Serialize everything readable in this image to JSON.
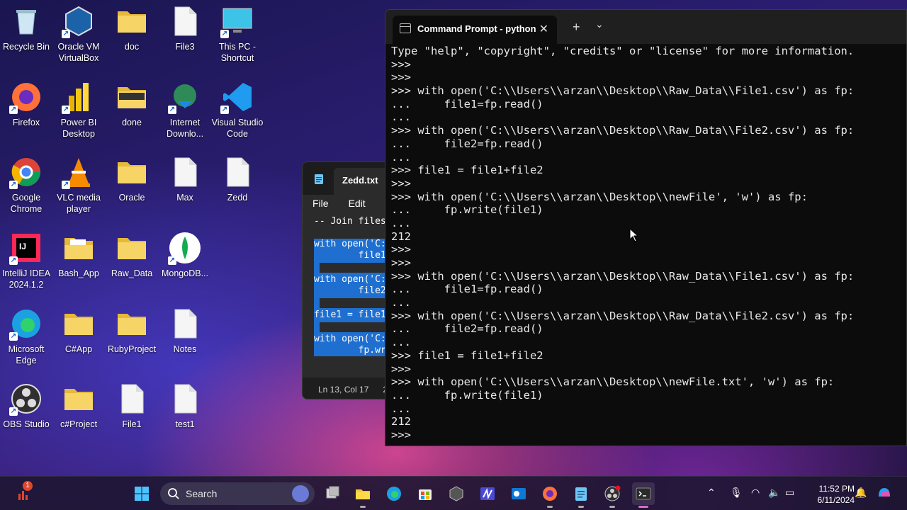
{
  "desktop": {
    "icons": [
      {
        "label": "Recycle Bin"
      },
      {
        "label": "Oracle VM VirtualBox"
      },
      {
        "label": "doc"
      },
      {
        "label": "File3"
      },
      {
        "label": "This PC - Shortcut"
      },
      {
        "label": "Firefox"
      },
      {
        "label": "Power BI Desktop"
      },
      {
        "label": "done"
      },
      {
        "label": "Internet Downlo..."
      },
      {
        "label": "Visual Studio Code"
      },
      {
        "label": "Google Chrome"
      },
      {
        "label": "VLC media player"
      },
      {
        "label": "Oracle"
      },
      {
        "label": "Max"
      },
      {
        "label": "Zedd"
      },
      {
        "label": "IntelliJ IDEA 2024.1.2"
      },
      {
        "label": "Bash_App"
      },
      {
        "label": "Raw_Data"
      },
      {
        "label": "MongoDB..."
      },
      {
        "label": "Microsoft Edge"
      },
      {
        "label": "C#App"
      },
      {
        "label": "RubyProject"
      },
      {
        "label": "Notes"
      },
      {
        "label": "OBS Studio"
      },
      {
        "label": "c#Project"
      },
      {
        "label": "File1"
      },
      {
        "label": "test1"
      }
    ]
  },
  "notepad": {
    "tab_title": "Zedd.txt",
    "menu": [
      "File",
      "Edit"
    ],
    "lines": {
      "comment": "-- Join files",
      "sel1": "with open('C:",
      "sel2": "        file1",
      "sel3": "with open('C:",
      "sel4": "        file2",
      "sel5": "file1 = file1",
      "sel6": "with open('C:",
      "sel7": "        fp.wr"
    },
    "status": {
      "position": "Ln 13, Col 17",
      "extra": "2"
    }
  },
  "terminal": {
    "tab_title": "Command Prompt - python",
    "lines": [
      "Type \"help\", \"copyright\", \"credits\" or \"license\" for more information.",
      ">>>",
      ">>>",
      ">>> with open('C:\\\\Users\\\\arzan\\\\Desktop\\\\Raw_Data\\\\File1.csv') as fp:",
      "...     file1=fp.read()",
      "...",
      ">>> with open('C:\\\\Users\\\\arzan\\\\Desktop\\\\Raw_Data\\\\File2.csv') as fp:",
      "...     file2=fp.read()",
      "...",
      ">>> file1 = file1+file2",
      ">>>",
      ">>> with open('C:\\\\Users\\\\arzan\\\\Desktop\\\\newFile', 'w') as fp:",
      "...     fp.write(file1)",
      "...",
      "212",
      ">>>",
      ">>>",
      ">>> with open('C:\\\\Users\\\\arzan\\\\Desktop\\\\Raw_Data\\\\File1.csv') as fp:",
      "...     file1=fp.read()",
      "...",
      ">>> with open('C:\\\\Users\\\\arzan\\\\Desktop\\\\Raw_Data\\\\File2.csv') as fp:",
      "...     file2=fp.read()",
      "...",
      ">>> file1 = file1+file2",
      ">>>",
      ">>> with open('C:\\\\Users\\\\arzan\\\\Desktop\\\\newFile.txt', 'w') as fp:",
      "...     fp.write(file1)",
      "...",
      "212",
      ">>>"
    ]
  },
  "taskbar": {
    "search_placeholder": "Search",
    "notification_badge": "1",
    "time": "11:52 PM",
    "date": "6/11/2024"
  }
}
